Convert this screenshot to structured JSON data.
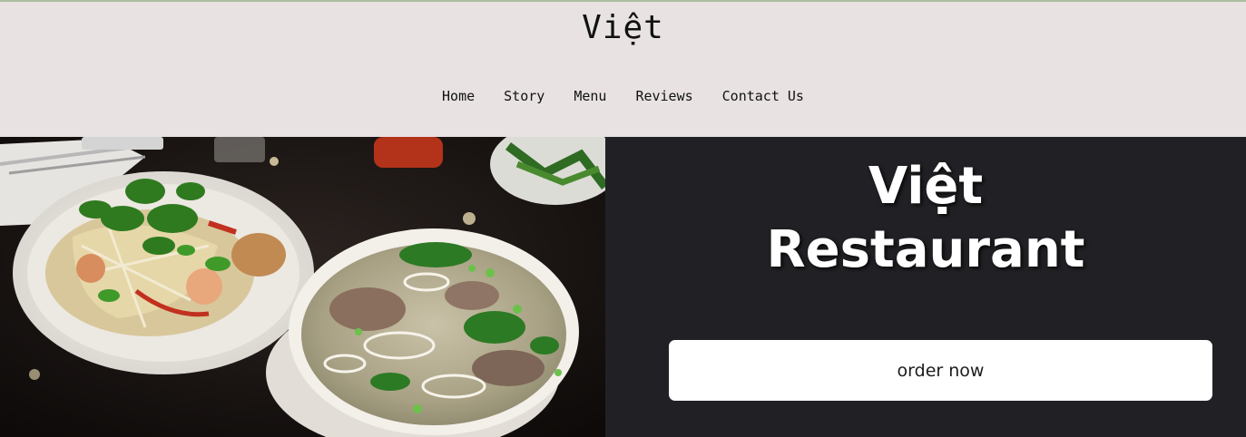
{
  "header": {
    "brand": "Việt",
    "nav": [
      {
        "label": "Home"
      },
      {
        "label": "Story"
      },
      {
        "label": "Menu"
      },
      {
        "label": "Reviews"
      },
      {
        "label": "Contact Us"
      }
    ]
  },
  "hero": {
    "title_line1": "Việt",
    "title_line2": "Restaurant",
    "order_button": "order now",
    "photo": "food-photo"
  },
  "colors": {
    "header_bg": "#e8e2e2",
    "panel_bg": "#212125",
    "button_bg": "#ffffff",
    "top_line": "#a9bf9f"
  }
}
